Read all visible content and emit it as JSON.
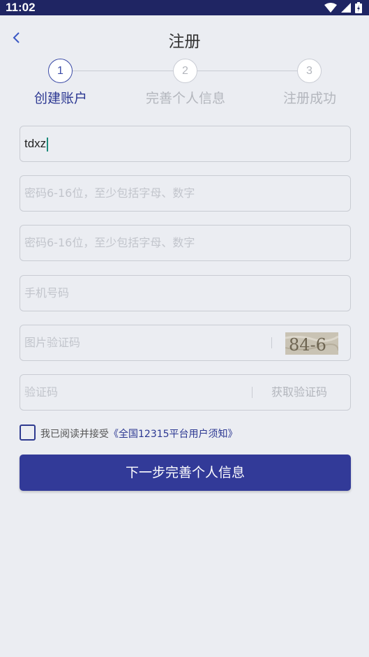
{
  "status_bar": {
    "time": "11:02"
  },
  "header": {
    "title": "注册"
  },
  "stepper": {
    "steps": [
      {
        "number": "1",
        "label": "创建账户"
      },
      {
        "number": "2",
        "label": "完善个人信息"
      },
      {
        "number": "3",
        "label": "注册成功"
      }
    ]
  },
  "form": {
    "username": {
      "value": "tdxz"
    },
    "password": {
      "placeholder": "密码6-16位，至少包括字母、数字"
    },
    "confirm_password": {
      "placeholder": "密码6-16位，至少包括字母、数字"
    },
    "phone": {
      "placeholder": "手机号码"
    },
    "image_captcha": {
      "placeholder": "图片验证码",
      "captcha_text": "84-6"
    },
    "sms_code": {
      "placeholder": "验证码",
      "get_code_label": "获取验证码"
    }
  },
  "agreement": {
    "prefix": "我已阅读并接受",
    "link": "《全国12315平台用户须知》"
  },
  "next_button": {
    "label": "下一步完善个人信息"
  },
  "colors": {
    "primary": "#323a98",
    "status_bar": "#1f2563",
    "background": "#ebedf2"
  }
}
